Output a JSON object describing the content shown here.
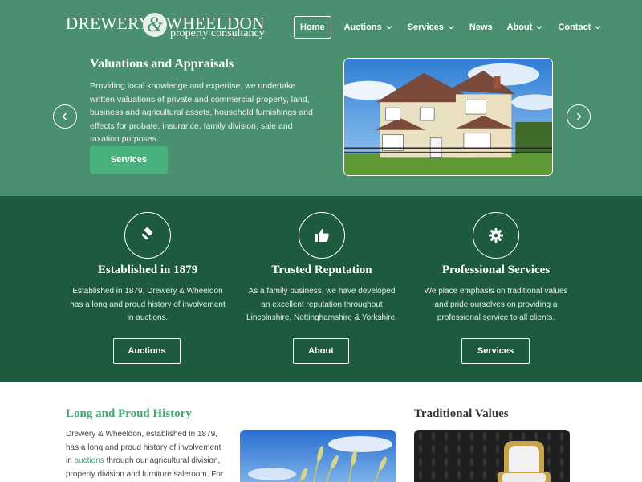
{
  "brand": {
    "name_left": "DREWERY",
    "ampersand": "&",
    "name_right": "WHEELDON",
    "tagline": "property consultancy"
  },
  "nav": {
    "items": [
      {
        "label": "Home",
        "active": true
      },
      {
        "label": "Auctions",
        "dropdown": true
      },
      {
        "label": "Services",
        "dropdown": true
      },
      {
        "label": "News"
      },
      {
        "label": "About",
        "dropdown": true
      },
      {
        "label": "Contact",
        "dropdown": true
      }
    ]
  },
  "hero": {
    "title": "Valuations and Appraisals",
    "text": "Providing local knowledge and expertise, we undertake written valuations of private and commercial property, land, business and agricultural assets, household furnishings and effects for probate, insurance, family division, sale and taxation purposes.",
    "button": "Services",
    "image_icon": "house-photo"
  },
  "features": [
    {
      "icon": "gavel-icon",
      "title": "Established in 1879",
      "text": "Established in 1879, Drewery & Wheeldon has a long and proud history of involvement in auctions.",
      "button": "Auctions"
    },
    {
      "icon": "thumbs-up-icon",
      "title": "Trusted Reputation",
      "text": "As a family business, we have developed an excellent reputation throughout Lincolnshire, Nottinghamshire & Yorkshire.",
      "button": "About"
    },
    {
      "icon": "gear-icon",
      "title": "Professional Services",
      "text": "We place emphasis on traditional values and pride ourselves on providing a professional service to all clients.",
      "button": "Services"
    }
  ],
  "history": {
    "title": "Long and Proud History",
    "text_before": "Drewery & Wheeldon, established in 1879, has a long and proud history of involvement in ",
    "link": "auctions",
    "text_after": " through our agricultural division, property division and furniture saleroom. For"
  },
  "values": {
    "title": "Traditional Values"
  },
  "colors": {
    "hero_bg": "#4a8f6e",
    "features_bg": "#1e5a3e",
    "accent": "#48b17e",
    "link": "#48a377"
  }
}
